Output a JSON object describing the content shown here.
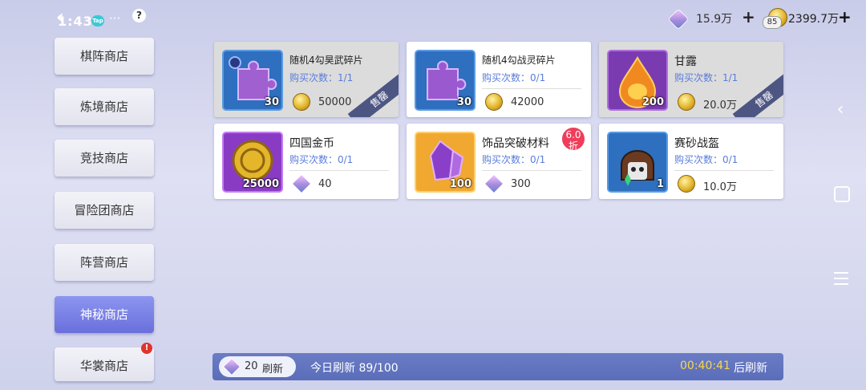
{
  "status": {
    "time": "1:43",
    "tap_badge": "Tap",
    "more": "···",
    "help": "?"
  },
  "currency": {
    "diamond_amount": "15.9万",
    "diamond_add": "+",
    "gold_level": "85",
    "gold_amount": "2399.7万",
    "gold_add": "+"
  },
  "sidebar": {
    "items": [
      {
        "label": "棋阵商店"
      },
      {
        "label": "炼境商店"
      },
      {
        "label": "竞技商店"
      },
      {
        "label": "冒险团商店"
      },
      {
        "label": "阵营商店"
      },
      {
        "label": "神秘商店",
        "active": true
      },
      {
        "label": "华裳商店",
        "notice": "!"
      }
    ]
  },
  "items": [
    {
      "name": "随机4勾昊武碎片",
      "limit": "购买次数：1/1",
      "qty": "30",
      "price": "50000",
      "currency": "coin-icon",
      "sold": true,
      "sold_label": "售罄"
    },
    {
      "name": "随机4勾战灵碎片",
      "limit": "购买次数：0/1",
      "qty": "30",
      "price": "42000",
      "currency": "coin-icon",
      "sold": false
    },
    {
      "name": "甘露",
      "limit": "购买次数：1/1",
      "qty": "200",
      "price": "20.0万",
      "currency": "coin-icon",
      "sold": true,
      "sold_label": "售罄"
    },
    {
      "name": "四国金币",
      "limit": "购买次数：0/1",
      "qty": "25000",
      "price": "40",
      "currency": "diamond-icon",
      "sold": false
    },
    {
      "name": "饰品突破材料",
      "limit": "购买次数：0/1",
      "qty": "100",
      "price": "300",
      "currency": "diamond-icon",
      "sold": false,
      "discount_value": "6.0",
      "discount_unit": "折"
    },
    {
      "name": "赛砂战盔",
      "limit": "购买次数：0/1",
      "qty": "1",
      "price": "10.0万",
      "currency": "coin-icon",
      "sold": false
    }
  ],
  "bottom": {
    "refresh_cost": "20",
    "refresh_label": "刷新",
    "today_refresh": "今日刷新 89/100",
    "countdown": "00:40:41",
    "countdown_suffix": "后刷新"
  },
  "colors": {
    "accent": "#6a6fdc",
    "limit_text": "#5a7ddb",
    "countdown": "#f7d84a",
    "sold_ribbon": "#4d5582",
    "discount": "#f03d5a"
  }
}
